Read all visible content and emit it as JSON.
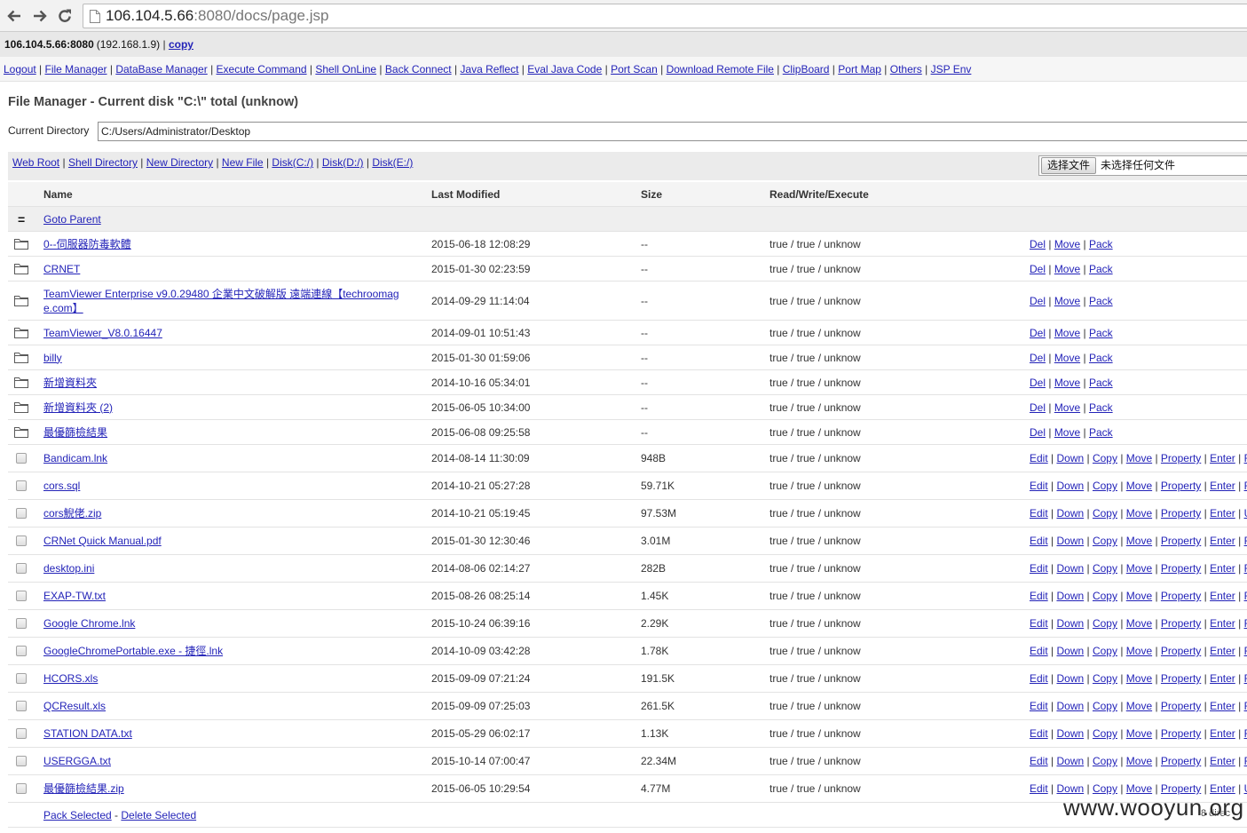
{
  "browser": {
    "url_host": "106.104.5.66",
    "url_path": ":8080/docs/page.jsp"
  },
  "info": {
    "host": "106.104.5.66:8080",
    "lan_ip": "(192.168.1.9)",
    "copy": "copy"
  },
  "separator": " | ",
  "nav": [
    "Logout",
    "File Manager",
    "DataBase Manager",
    "Execute Command",
    "Shell OnLine",
    "Back Connect",
    "Java Reflect",
    "Eval Java Code",
    "Port Scan",
    "Download Remote File",
    "ClipBoard",
    "Port Map",
    "Others",
    "JSP Env"
  ],
  "heading": "File Manager - Current disk \"C:\\\" total (unknow)",
  "current_dir": {
    "label": "Current Directory",
    "value": "C:/Users/Administrator/Desktop"
  },
  "toolbar": [
    "Web Root",
    "Shell Directory",
    "New Directory",
    "New File",
    "Disk(C:/)",
    "Disk(D:/)",
    "Disk(E:/)"
  ],
  "upload": {
    "button": "选择文件",
    "status": "未选择任何文件"
  },
  "columns": {
    "name": "Name",
    "modified": "Last Modified",
    "size": "Size",
    "rwx": "Read/Write/Execute"
  },
  "parent": {
    "icon": "=",
    "label": "Goto Parent"
  },
  "folder_actions": [
    "Del",
    "Move",
    "Pack"
  ],
  "file_actions": [
    "Edit",
    "Down",
    "Copy",
    "Move",
    "Property",
    "Enter"
  ],
  "folders": [
    {
      "name": "0--伺服器防毒軟體",
      "modified": "2015-06-18 12:08:29",
      "size": "--",
      "rwx": "true / true / unknow"
    },
    {
      "name": "CRNET",
      "modified": "2015-01-30 02:23:59",
      "size": "--",
      "rwx": "true / true / unknow"
    },
    {
      "name": "TeamViewer Enterprise v9.0.29480 企業中文破解版 遠端連線【techroomage.com】",
      "modified": "2014-09-29 11:14:04",
      "size": "--",
      "rwx": "true / true / unknow"
    },
    {
      "name": "TeamViewer_V8.0.16447",
      "modified": "2014-09-01 10:51:43",
      "size": "--",
      "rwx": "true / true / unknow"
    },
    {
      "name": "billy",
      "modified": "2015-01-30 01:59:06",
      "size": "--",
      "rwx": "true / true / unknow"
    },
    {
      "name": "新增資料夾",
      "modified": "2014-10-16 05:34:01",
      "size": "--",
      "rwx": "true / true / unknow"
    },
    {
      "name": "新增資料夾 (2)",
      "modified": "2015-06-05 10:34:00",
      "size": "--",
      "rwx": "true / true / unknow"
    },
    {
      "name": "最優篩檢結果",
      "modified": "2015-06-08 09:25:58",
      "size": "--",
      "rwx": "true / true / unknow"
    }
  ],
  "files": [
    {
      "name": "Bandicam.lnk",
      "modified": "2014-08-14 11:30:09",
      "size": "948B",
      "rwx": "true / true / unknow",
      "more": "F"
    },
    {
      "name": "cors.sql",
      "modified": "2014-10-21 05:27:28",
      "size": "59.71K",
      "rwx": "true / true / unknow",
      "more": "F"
    },
    {
      "name": "cors鯢佬.zip",
      "modified": "2014-10-21 05:19:45",
      "size": "97.53M",
      "rwx": "true / true / unknow",
      "more": "U"
    },
    {
      "name": "CRNet Quick Manual.pdf",
      "modified": "2015-01-30 12:30:46",
      "size": "3.01M",
      "rwx": "true / true / unknow",
      "more": "F"
    },
    {
      "name": "desktop.ini",
      "modified": "2014-08-06 02:14:27",
      "size": "282B",
      "rwx": "true / true / unknow",
      "more": "F"
    },
    {
      "name": "EXAP-TW.txt",
      "modified": "2015-08-26 08:25:14",
      "size": "1.45K",
      "rwx": "true / true / unknow",
      "more": "F"
    },
    {
      "name": "Google Chrome.lnk",
      "modified": "2015-10-24 06:39:16",
      "size": "2.29K",
      "rwx": "true / true / unknow",
      "more": "F"
    },
    {
      "name": "GoogleChromePortable.exe - 捷徑.lnk",
      "modified": "2014-10-09 03:42:28",
      "size": "1.78K",
      "rwx": "true / true / unknow",
      "more": "F"
    },
    {
      "name": "HCORS.xls",
      "modified": "2015-09-09 07:21:24",
      "size": "191.5K",
      "rwx": "true / true / unknow",
      "more": "F"
    },
    {
      "name": "QCResult.xls",
      "modified": "2015-09-09 07:25:03",
      "size": "261.5K",
      "rwx": "true / true / unknow",
      "more": "F"
    },
    {
      "name": "STATION DATA.txt",
      "modified": "2015-05-29 06:02:17",
      "size": "1.13K",
      "rwx": "true / true / unknow",
      "more": "F"
    },
    {
      "name": "USERGGA.txt",
      "modified": "2015-10-14 07:00:47",
      "size": "22.34M",
      "rwx": "true / true / unknow",
      "more": "F"
    },
    {
      "name": "最優篩檢結果.zip",
      "modified": "2015-06-05 10:29:54",
      "size": "4.77M",
      "rwx": "true / true / unknow",
      "more": "U"
    }
  ],
  "footer": {
    "pack": "Pack Selected",
    "dash": " - ",
    "delete": "Delete Selected",
    "count": "8 direc"
  },
  "watermark": "www.wooyun.org",
  "icons": {
    "back": "back-arrow-icon",
    "forward": "forward-arrow-icon",
    "reload": "reload-icon",
    "page": "page-icon",
    "folder": "folder-icon",
    "parent": "goto-parent-icon",
    "file": "file-checkbox"
  },
  "colors": {
    "link": "#2323b8",
    "text": "#333333",
    "header_strip": "#e8e8e8",
    "toolbar": "#ebebeb"
  }
}
